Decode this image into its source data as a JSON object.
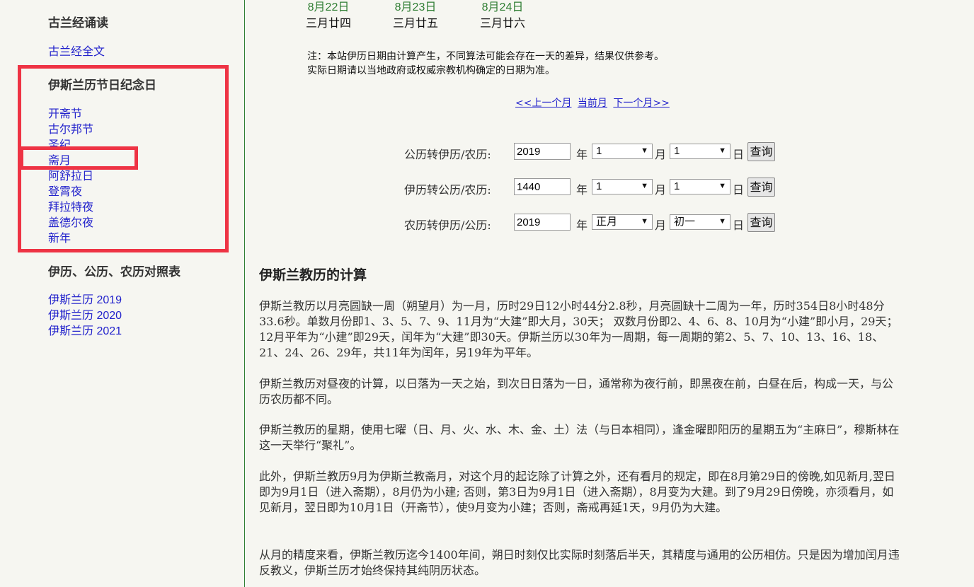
{
  "sidebar": {
    "section1_title": "古兰经诵读",
    "quran_link": "古兰经全文",
    "section2_title": "伊斯兰历节日纪念日",
    "festivals": [
      "开斋节",
      "古尔邦节",
      "圣纪",
      "斋月",
      "阿舒拉日",
      "登霄夜",
      "拜拉特夜",
      "盖德尔夜",
      "新年"
    ],
    "section3_title": "伊历、公历、农历对照表",
    "tables": [
      "伊斯兰历 2019",
      "伊斯兰历 2020",
      "伊斯兰历 2021"
    ]
  },
  "dates": [
    {
      "gregorian": "8月22日",
      "lunar": "三月廿四"
    },
    {
      "gregorian": "8月23日",
      "lunar": "三月廿五"
    },
    {
      "gregorian": "8月24日",
      "lunar": "三月廿六"
    }
  ],
  "note": {
    "line1": "注：本站伊历日期由计算产生，不同算法可能会存在一天的差异，结果仅供参考。",
    "line2": "实际日期请以当地政府或权威宗教机构确定的日期为准。"
  },
  "nav": {
    "prev": "<<上一个月",
    "current": "当前月",
    "next": "下一个月>>"
  },
  "converters": [
    {
      "label": "公历转伊历/农历:",
      "year": "2019",
      "month": "1",
      "day": "1",
      "button": "查询"
    },
    {
      "label": "伊历转公历/农历:",
      "year": "1440",
      "month": "1",
      "day": "1",
      "button": "查询"
    },
    {
      "label": "农历转伊历/公历:",
      "year": "2019",
      "month": "正月",
      "day": "初一",
      "button": "查询"
    }
  ],
  "units": {
    "year": "年",
    "month": "月",
    "day": "日"
  },
  "article": {
    "title": "伊斯兰教历的计算",
    "p1": "伊斯兰教历以月亮圆缺一周（朔望月）为一月，历时29日12小时44分2.8秒，月亮圆缺十二周为一年，历时354日8小时48分33.6秒。单数月份即1、3、5、7、9、11月为“大建”即大月，30天； 双数月份即2、4、6、8、10月为“小建”即小月，29天；12月平年为“小建”即29天，闰年为“大建”即30天。伊斯兰历以30年为一周期，每一周期的第2、5、7、10、13、16、18、21、24、26、29年，共11年为闰年，另19年为平年。",
    "p2": "伊斯兰教历对昼夜的计算，以日落为一天之始，到次日日落为一日，通常称为夜行前，即黑夜在前，白昼在后，构成一天，与公历农历都不同。",
    "p3": "伊斯兰教历的星期，使用七曜（日、月、火、水、木、金、土）法（与日本相同），逢金曜即阳历的星期五为“主麻日”，穆斯林在这一天举行“聚礼”。",
    "p4": "此外，伊斯兰教历9月为伊斯兰教斋月，对这个月的起讫除了计算之外，还有看月的规定，即在8月第29日的傍晚,如见新月,翌日即为9月1日（进入斋期），8月仍为小建; 否则，第3日为9月1日（进入斋期），8月变为大建。到了9月29日傍晚，亦须看月，如见新月，翌日即为10月1日（开斋节），使9月变为小建；否则，斋戒再延1天，9月仍为大建。",
    "p5": "从月的精度来看，伊斯兰教历迄今1400年间，朔日时刻仅比实际时刻落后半天，其精度与通用的公历相仿。只是因为增加闰月违反教义，伊斯兰历才始终保持其纯阴历状态。"
  }
}
